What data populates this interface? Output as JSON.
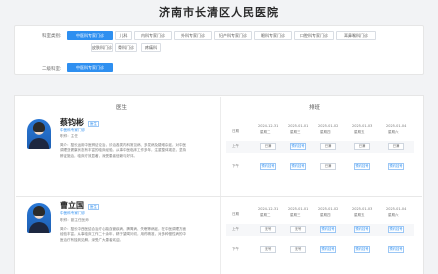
{
  "title": "济南市长清区人民医院",
  "filter": {
    "dept_label": "科室类别:",
    "depts": [
      "中医科专家门诊",
      "儿科",
      "内科专家门诊",
      "外科专家门诊",
      "妇产科专家门诊",
      "眼科专家门诊",
      "口腔科专家门诊",
      "耳鼻喉科门诊",
      "皮肤科门诊",
      "骨科门诊",
      "疼痛科"
    ],
    "sub_label": "二级科室:",
    "subs": [
      "中医科专家门诊"
    ]
  },
  "columns": {
    "doctor": "医生",
    "schedule": "排班"
  },
  "doctors": [
    {
      "name": "蔡钧彬",
      "badge": "医生",
      "dept": "中医科专家门诊",
      "title_line": "职称：主任",
      "intro": "简介：擅长运用中医辨证论治，诊治各类内科常见病、多发病及疑难杂症，对中医调理亚健康状态有丰富的临床经验。从事中医临床工作多年，注重整体观念，坚持辨证施治，临床疗效显著，深受患者信赖与好评。"
    },
    {
      "name": "曹立国",
      "badge": "医生",
      "dept": "中医科专家门诊",
      "title_line": "职称：副主任医师",
      "intro": "简介：擅长中西医结合治疗心脑血管疾病、脾胃病、失眠等病症，在中医调理方面经验丰富。从事临床工作二十余年，精于望闻问切，用药精准，对多种慢性病的中医治疗有独到见解，深受广大患者欢迎。"
    }
  ],
  "schedule": {
    "headers": [
      {
        "label": "日期"
      },
      {
        "date": "2024-12-31",
        "weekday": "星期二"
      },
      {
        "date": "2025-01-01",
        "weekday": "星期三"
      },
      {
        "date": "2025-01-02",
        "weekday": "星期四"
      },
      {
        "date": "2025-01-03",
        "weekday": "星期五"
      },
      {
        "date": "2025-01-04",
        "weekday": "星期六"
      }
    ],
    "rows": [
      {
        "doctor": 0,
        "am": "上午",
        "pm": "下午",
        "am_slots": [
          "已满",
          "预约挂号",
          "已满",
          "已满",
          "已满"
        ],
        "pm_slots": [
          "预约挂号",
          "预约挂号",
          "已满",
          "预约挂号",
          "预约挂号"
        ]
      },
      {
        "doctor": 1,
        "am": "上午",
        "pm": "下午",
        "am_slots": [
          "无号",
          "无号",
          "预约挂号",
          "预约挂号",
          "预约挂号"
        ],
        "pm_slots": [
          "无号",
          "无号",
          "预约挂号",
          "预约挂号",
          "预约挂号"
        ]
      }
    ]
  }
}
